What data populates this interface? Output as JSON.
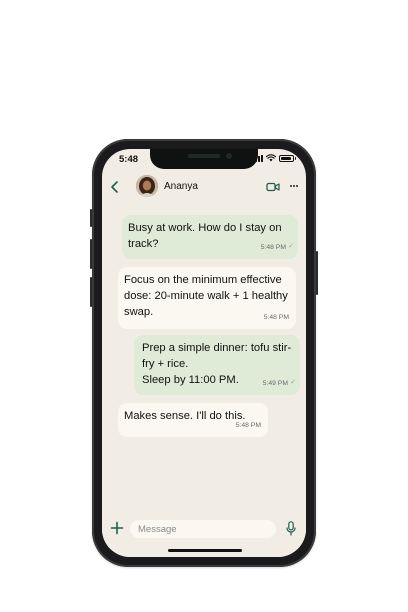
{
  "status_bar": {
    "time": "5:48"
  },
  "chat": {
    "contact_name": "Ananya",
    "messages": [
      {
        "direction": "outgoing",
        "text": "Busy at work. How do I stay on track?",
        "time": "5:48 PM"
      },
      {
        "direction": "incoming",
        "text": "Focus on the minimum effective dose: 20-minute walk + 1 healthy swap.",
        "time": "5:48 PM"
      },
      {
        "direction": "outgoing",
        "text": "Prep a simple dinner: tofu stir-fry + rice.\nSleep by 11:00 PM.",
        "time": "5:49 PM"
      },
      {
        "direction": "incoming",
        "text": "Makes sense. I'll do this.",
        "time": "5:48 PM"
      }
    ]
  },
  "composer": {
    "placeholder": "Message"
  },
  "icons": {
    "back": "chevron-left-icon",
    "video": "video-call-icon",
    "more": "more-options-icon",
    "attach": "plus-icon",
    "mic": "microphone-icon"
  },
  "colors": {
    "accent": "#1f5f4f",
    "background": "#f1ede4",
    "outgoing_bubble": "#dfebd7",
    "incoming_bubble": "#fbf8f1"
  }
}
